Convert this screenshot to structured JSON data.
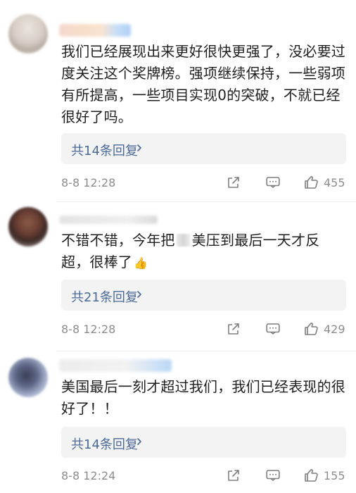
{
  "comments": [
    {
      "text": "我们已经展现出来更好很快更强了，没必要过度关注这个奖牌榜。强项继续保持，一些弱项有所提高，一些项目实现0的突破，不就已经很好了吗。",
      "replies": "共14条回复",
      "time": "8-8 12:28",
      "likes": "455"
    },
    {
      "text_before": "不错不错，今年把",
      "text_after": "美压到最后一天才反超，很棒了",
      "replies": "共21条回复",
      "time": "8-8 12:28",
      "likes": "429"
    },
    {
      "text": "美国最后一刻才超过我们，我们已经表现的很好了！！",
      "replies": "共14条回复",
      "time": "8-8 12:24",
      "likes": "155"
    }
  ],
  "icons": {
    "reply_chevron": "chevron-right-icon",
    "share": "share-icon",
    "comment": "comment-icon",
    "like": "thumbs-up-icon",
    "emoji": "thumbs-up-emoji"
  },
  "colors": {
    "link": "#4b6a98",
    "meta": "#8d8d8d"
  }
}
